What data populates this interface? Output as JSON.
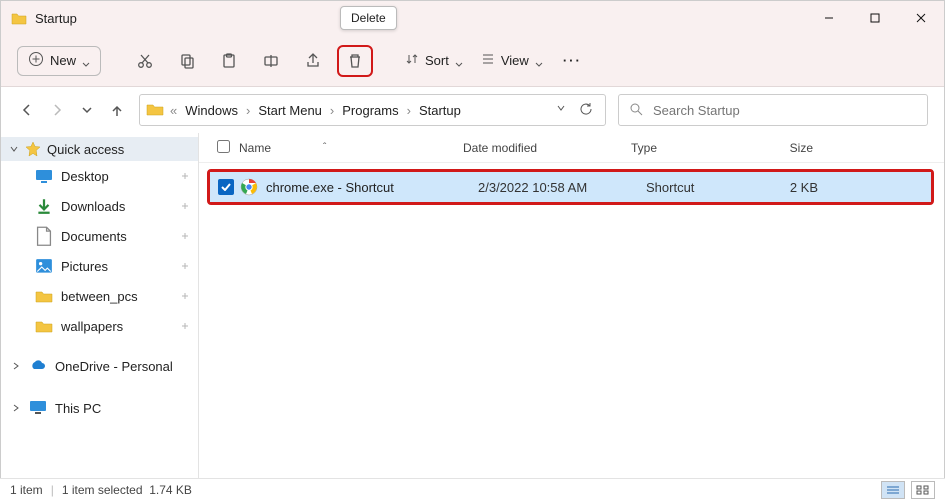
{
  "window": {
    "title": "Startup"
  },
  "tooltip": {
    "delete": "Delete"
  },
  "toolbar": {
    "new_label": "New",
    "sort_label": "Sort",
    "view_label": "View"
  },
  "breadcrumbs": {
    "items": [
      "Windows",
      "Start Menu",
      "Programs",
      "Startup"
    ]
  },
  "search": {
    "placeholder": "Search Startup"
  },
  "sidebar": {
    "quick_access": "Quick access",
    "items": [
      {
        "label": "Desktop",
        "icon": "desktop"
      },
      {
        "label": "Downloads",
        "icon": "downloads"
      },
      {
        "label": "Documents",
        "icon": "documents"
      },
      {
        "label": "Pictures",
        "icon": "pictures"
      },
      {
        "label": "between_pcs",
        "icon": "folder"
      },
      {
        "label": "wallpapers",
        "icon": "folder"
      }
    ],
    "onedrive": "OneDrive - Personal",
    "this_pc": "This PC"
  },
  "columns": {
    "name": "Name",
    "date": "Date modified",
    "type": "Type",
    "size": "Size"
  },
  "rows": [
    {
      "name": "chrome.exe - Shortcut",
      "date": "2/3/2022 10:58 AM",
      "type": "Shortcut",
      "size": "2 KB"
    }
  ],
  "status": {
    "count": "1 item",
    "selection": "1 item selected",
    "size": "1.74 KB"
  }
}
